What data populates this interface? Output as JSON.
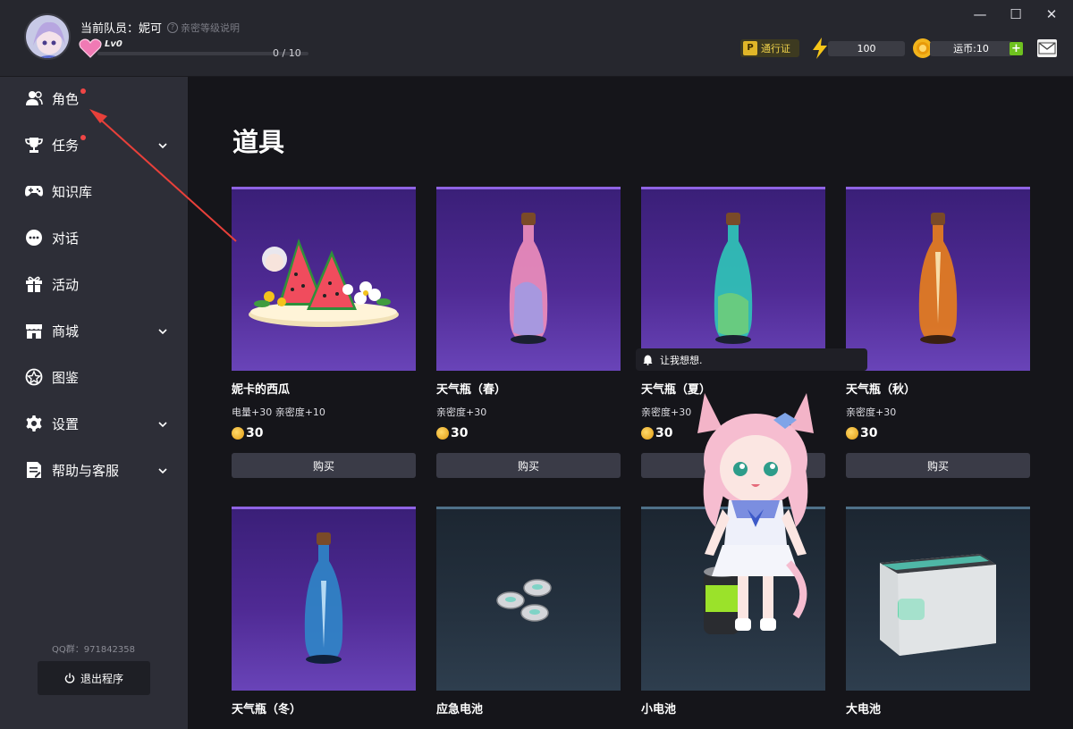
{
  "header": {
    "member_label": "当前队员：妮可",
    "help_text": "亲密等级说明",
    "level_badge": "Lv0",
    "xp_text": "0 / 10",
    "pass_label": "通行证",
    "energy_value": "100",
    "coin_label": "运币:10",
    "plus_symbol": "+",
    "colors": {
      "accent_gold": "#f0d24a",
      "energy": "#f5c518",
      "plus": "#6ec11f"
    }
  },
  "window_controls": {
    "minimize": "—",
    "maximize": "☐",
    "close": "✕"
  },
  "sidebar": {
    "items": [
      {
        "label": "角色",
        "icon": "person-icon",
        "dot": true,
        "chevron": false
      },
      {
        "label": "任务",
        "icon": "trophy-icon",
        "dot": true,
        "chevron": true
      },
      {
        "label": "知识库",
        "icon": "gamepad-icon",
        "dot": false,
        "chevron": false
      },
      {
        "label": "对话",
        "icon": "chat-icon",
        "dot": false,
        "chevron": false
      },
      {
        "label": "活动",
        "icon": "gift-icon",
        "dot": false,
        "chevron": false
      },
      {
        "label": "商城",
        "icon": "shop-icon",
        "dot": false,
        "chevron": true
      },
      {
        "label": "图鉴",
        "icon": "badge-icon",
        "dot": false,
        "chevron": false
      },
      {
        "label": "设置",
        "icon": "gear-icon",
        "dot": false,
        "chevron": true
      },
      {
        "label": "帮助与客服",
        "icon": "document-icon",
        "dot": false,
        "chevron": true
      }
    ],
    "qq_group": "QQ群：971842358",
    "exit_label": "退出程序"
  },
  "main": {
    "title": "道具",
    "bubble_text": "让我想想.",
    "items": [
      {
        "name": "妮卡的西瓜",
        "desc": "电量+30 亲密度+10",
        "price": "30",
        "buy": "购买",
        "art": "watermelon"
      },
      {
        "name": "天气瓶（春）",
        "desc": "亲密度+30",
        "price": "30",
        "buy": "购买",
        "art": "bottle-pink"
      },
      {
        "name": "天气瓶（夏）",
        "desc": "亲密度+30",
        "price": "30",
        "buy": "购买",
        "art": "bottle-cyan"
      },
      {
        "name": "天气瓶（秋）",
        "desc": "亲密度+30",
        "price": "30",
        "buy": "购买",
        "art": "bottle-orange"
      },
      {
        "name": "天气瓶（冬）",
        "art": "bottle-blue"
      },
      {
        "name": "应急电池",
        "art": "coins"
      },
      {
        "name": "小电池",
        "art": "battery-small"
      },
      {
        "name": "大电池",
        "art": "battery-big"
      }
    ]
  }
}
